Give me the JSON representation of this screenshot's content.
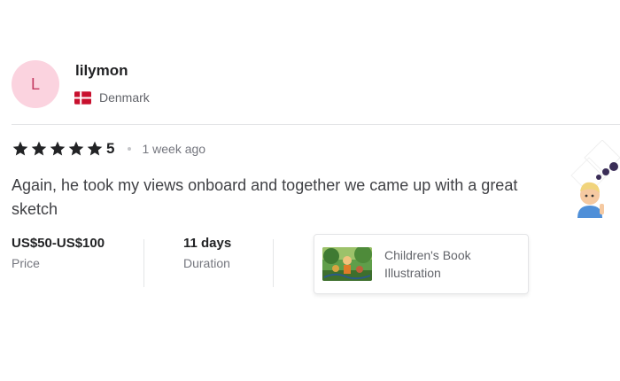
{
  "reviewer": {
    "avatar_initial": "L",
    "username": "lilymon",
    "country": "Denmark",
    "flag": "denmark-flag-icon"
  },
  "review": {
    "stars": 5,
    "rating": "5",
    "time_ago": "1 week ago",
    "text": "Again, he took my views onboard and together we came up with a great sketch"
  },
  "stats": {
    "price_value": "US$50-US$100",
    "price_label": "Price",
    "duration_value": "11 days",
    "duration_label": "Duration"
  },
  "gig": {
    "title": "Children's Book Illustration",
    "thumbnail": "children-book-illustration-thumbnail"
  },
  "colors": {
    "avatar_bg": "#fbd3df",
    "avatar_text": "#c43b62",
    "star": "#222325",
    "flag_red": "#c8102e"
  }
}
